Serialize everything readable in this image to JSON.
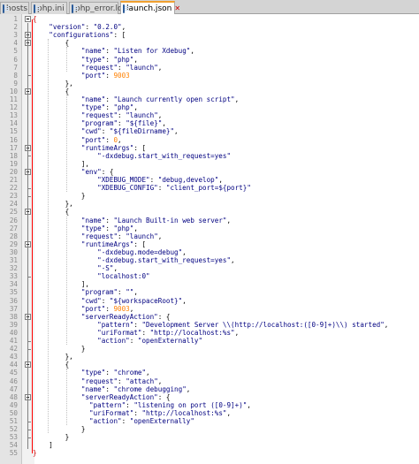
{
  "tabs": [
    {
      "label": "hosts",
      "active": false
    },
    {
      "label": "php.ini",
      "active": false
    },
    {
      "label": "php_error.log",
      "active": false
    },
    {
      "label": "launch.json",
      "active": true
    }
  ],
  "lines": [
    [
      [
        "lbr",
        "{"
      ]
    ],
    [
      [
        "pun",
        "    "
      ],
      [
        "key",
        "\"version\""
      ],
      [
        "pun",
        ": "
      ],
      [
        "str",
        "\"0.2.0\""
      ],
      [
        "pun",
        ","
      ]
    ],
    [
      [
        "pun",
        "    "
      ],
      [
        "key",
        "\"configurations\""
      ],
      [
        "pun",
        ": ["
      ]
    ],
    [
      [
        "pun",
        "        {"
      ]
    ],
    [
      [
        "pun",
        "            "
      ],
      [
        "key",
        "\"name\""
      ],
      [
        "pun",
        ": "
      ],
      [
        "str",
        "\"Listen for Xdebug\""
      ],
      [
        "pun",
        ","
      ]
    ],
    [
      [
        "pun",
        "            "
      ],
      [
        "key",
        "\"type\""
      ],
      [
        "pun",
        ": "
      ],
      [
        "str",
        "\"php\""
      ],
      [
        "pun",
        ","
      ]
    ],
    [
      [
        "pun",
        "            "
      ],
      [
        "key",
        "\"request\""
      ],
      [
        "pun",
        ": "
      ],
      [
        "str",
        "\"launch\""
      ],
      [
        "pun",
        ","
      ]
    ],
    [
      [
        "pun",
        "            "
      ],
      [
        "key",
        "\"port\""
      ],
      [
        "pun",
        ": "
      ],
      [
        "num",
        "9003"
      ]
    ],
    [
      [
        "pun",
        "        },"
      ]
    ],
    [
      [
        "pun",
        "        {"
      ]
    ],
    [
      [
        "pun",
        "            "
      ],
      [
        "key",
        "\"name\""
      ],
      [
        "pun",
        ": "
      ],
      [
        "str",
        "\"Launch currently open script\""
      ],
      [
        "pun",
        ","
      ]
    ],
    [
      [
        "pun",
        "            "
      ],
      [
        "key",
        "\"type\""
      ],
      [
        "pun",
        ": "
      ],
      [
        "str",
        "\"php\""
      ],
      [
        "pun",
        ","
      ]
    ],
    [
      [
        "pun",
        "            "
      ],
      [
        "key",
        "\"request\""
      ],
      [
        "pun",
        ": "
      ],
      [
        "str",
        "\"launch\""
      ],
      [
        "pun",
        ","
      ]
    ],
    [
      [
        "pun",
        "            "
      ],
      [
        "key",
        "\"program\""
      ],
      [
        "pun",
        ": "
      ],
      [
        "str",
        "\"${file}\""
      ],
      [
        "pun",
        ","
      ]
    ],
    [
      [
        "pun",
        "            "
      ],
      [
        "key",
        "\"cwd\""
      ],
      [
        "pun",
        ": "
      ],
      [
        "str",
        "\"${fileDirname}\""
      ],
      [
        "pun",
        ","
      ]
    ],
    [
      [
        "pun",
        "            "
      ],
      [
        "key",
        "\"port\""
      ],
      [
        "pun",
        ": "
      ],
      [
        "num",
        "0"
      ],
      [
        "pun",
        ","
      ]
    ],
    [
      [
        "pun",
        "            "
      ],
      [
        "key",
        "\"runtimeArgs\""
      ],
      [
        "pun",
        ": ["
      ]
    ],
    [
      [
        "pun",
        "                "
      ],
      [
        "str",
        "\"-dxdebug.start_with_request=yes\""
      ]
    ],
    [
      [
        "pun",
        "            ],"
      ]
    ],
    [
      [
        "pun",
        "            "
      ],
      [
        "key",
        "\"env\""
      ],
      [
        "pun",
        ": {"
      ]
    ],
    [
      [
        "pun",
        "                "
      ],
      [
        "key",
        "\"XDEBUG_MODE\""
      ],
      [
        "pun",
        ": "
      ],
      [
        "str",
        "\"debug,develop\""
      ],
      [
        "pun",
        ","
      ]
    ],
    [
      [
        "pun",
        "                "
      ],
      [
        "key",
        "\"XDEBUG_CONFIG\""
      ],
      [
        "pun",
        ": "
      ],
      [
        "str",
        "\"client_port=${port}\""
      ]
    ],
    [
      [
        "pun",
        "            }"
      ]
    ],
    [
      [
        "pun",
        "        },"
      ]
    ],
    [
      [
        "pun",
        "        {"
      ]
    ],
    [
      [
        "pun",
        "            "
      ],
      [
        "key",
        "\"name\""
      ],
      [
        "pun",
        ": "
      ],
      [
        "str",
        "\"Launch Built-in web server\""
      ],
      [
        "pun",
        ","
      ]
    ],
    [
      [
        "pun",
        "            "
      ],
      [
        "key",
        "\"type\""
      ],
      [
        "pun",
        ": "
      ],
      [
        "str",
        "\"php\""
      ],
      [
        "pun",
        ","
      ]
    ],
    [
      [
        "pun",
        "            "
      ],
      [
        "key",
        "\"request\""
      ],
      [
        "pun",
        ": "
      ],
      [
        "str",
        "\"launch\""
      ],
      [
        "pun",
        ","
      ]
    ],
    [
      [
        "pun",
        "            "
      ],
      [
        "key",
        "\"runtimeArgs\""
      ],
      [
        "pun",
        ": ["
      ]
    ],
    [
      [
        "pun",
        "                "
      ],
      [
        "str",
        "\"-dxdebug.mode=debug\""
      ],
      [
        "pun",
        ","
      ]
    ],
    [
      [
        "pun",
        "                "
      ],
      [
        "str",
        "\"-dxdebug.start_with_request=yes\""
      ],
      [
        "pun",
        ","
      ]
    ],
    [
      [
        "pun",
        "                "
      ],
      [
        "str",
        "\"-S\""
      ],
      [
        "pun",
        ","
      ]
    ],
    [
      [
        "pun",
        "                "
      ],
      [
        "str",
        "\"localhost:0\""
      ]
    ],
    [
      [
        "pun",
        "            ],"
      ]
    ],
    [
      [
        "pun",
        "            "
      ],
      [
        "key",
        "\"program\""
      ],
      [
        "pun",
        ": "
      ],
      [
        "str",
        "\"\""
      ],
      [
        "pun",
        ","
      ]
    ],
    [
      [
        "pun",
        "            "
      ],
      [
        "key",
        "\"cwd\""
      ],
      [
        "pun",
        ": "
      ],
      [
        "str",
        "\"${workspaceRoot}\""
      ],
      [
        "pun",
        ","
      ]
    ],
    [
      [
        "pun",
        "            "
      ],
      [
        "key",
        "\"port\""
      ],
      [
        "pun",
        ": "
      ],
      [
        "num",
        "9003"
      ],
      [
        "pun",
        ","
      ]
    ],
    [
      [
        "pun",
        "            "
      ],
      [
        "key",
        "\"serverReadyAction\""
      ],
      [
        "pun",
        ": {"
      ]
    ],
    [
      [
        "pun",
        "                "
      ],
      [
        "key",
        "\"pattern\""
      ],
      [
        "pun",
        ": "
      ],
      [
        "str",
        "\"Development Server \\\\(http://localhost:([0-9]+)\\\\) started\""
      ],
      [
        "pun",
        ","
      ]
    ],
    [
      [
        "pun",
        "                "
      ],
      [
        "key",
        "\"uriFormat\""
      ],
      [
        "pun",
        ": "
      ],
      [
        "str",
        "\"http://localhost:%s\""
      ],
      [
        "pun",
        ","
      ]
    ],
    [
      [
        "pun",
        "                "
      ],
      [
        "key",
        "\"action\""
      ],
      [
        "pun",
        ": "
      ],
      [
        "str",
        "\"openExternally\""
      ]
    ],
    [
      [
        "pun",
        "            }"
      ]
    ],
    [
      [
        "pun",
        "        },"
      ]
    ],
    [
      [
        "pun",
        "        {"
      ]
    ],
    [
      [
        "pun",
        "            "
      ],
      [
        "key",
        "\"type\""
      ],
      [
        "pun",
        ": "
      ],
      [
        "str",
        "\"chrome\""
      ],
      [
        "pun",
        ","
      ]
    ],
    [
      [
        "pun",
        "            "
      ],
      [
        "key",
        "\"request\""
      ],
      [
        "pun",
        ": "
      ],
      [
        "str",
        "\"attach\""
      ],
      [
        "pun",
        ","
      ]
    ],
    [
      [
        "pun",
        "            "
      ],
      [
        "key",
        "\"name\""
      ],
      [
        "pun",
        ": "
      ],
      [
        "str",
        "\"chrome debugging\""
      ],
      [
        "pun",
        ","
      ]
    ],
    [
      [
        "pun",
        "            "
      ],
      [
        "key",
        "\"serverReadyAction\""
      ],
      [
        "pun",
        ": {"
      ]
    ],
    [
      [
        "pun",
        "              "
      ],
      [
        "key",
        "\"pattern\""
      ],
      [
        "pun",
        ": "
      ],
      [
        "str",
        "\"listening on port ([0-9]+)\""
      ],
      [
        "pun",
        ","
      ]
    ],
    [
      [
        "pun",
        "              "
      ],
      [
        "key",
        "\"uriFormat\""
      ],
      [
        "pun",
        ": "
      ],
      [
        "str",
        "\"http://localhost:%s\""
      ],
      [
        "pun",
        ","
      ]
    ],
    [
      [
        "pun",
        "              "
      ],
      [
        "key",
        "\"action\""
      ],
      [
        "pun",
        ": "
      ],
      [
        "str",
        "\"openExternally\""
      ]
    ],
    [
      [
        "pun",
        "            }"
      ]
    ],
    [
      [
        "pun",
        "        }"
      ]
    ],
    [
      [
        "pun",
        "    ]"
      ]
    ],
    [
      [
        "lbr",
        "}"
      ]
    ]
  ],
  "folds": [
    1,
    3,
    4,
    10,
    17,
    20,
    25,
    29,
    38,
    44,
    48
  ],
  "colors": {
    "keyword": "#000080",
    "number": "#ff8000",
    "brace_match": "#ff0000",
    "active_tab_accent": "#f0a030"
  }
}
